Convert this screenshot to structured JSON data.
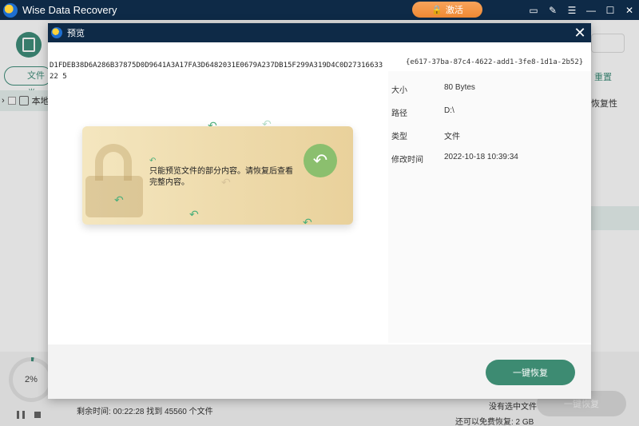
{
  "app": {
    "title": "Wise Data Recovery",
    "activate_label": "激活",
    "lock_glyph": "🔒"
  },
  "window_controls": {
    "feedback": "▭",
    "edit": "✎",
    "menu": "☰",
    "minimize": "—",
    "maximize": "☐",
    "close": "✕"
  },
  "background": {
    "file_tab_label": "文件类",
    "reset_label": "重置",
    "local_disk_label": "本地",
    "recoverable_label": "恢复性",
    "progress_percent": "2%",
    "progress_fraction": 0.02,
    "remaining_text": "剩余时间: 00:22:28 找到 45560 个文件",
    "no_selection_text": "没有选中文件",
    "free_left_text": "还可以免费恢复:  2 GB",
    "bg_recover_label": "一键恢复"
  },
  "dialog": {
    "title": "预览",
    "close_glyph": "✕",
    "hex_content": "D1FDEB38D6A286B37875D0D9641A3A17FA3D6482031E0679A237DB15F299A319D4C0D2731663322 5",
    "guid": "{e617-37ba-87c4-4622-add1-3fe8-1d1a-2b52}",
    "info": [
      {
        "key": "大小",
        "value": "80 Bytes"
      },
      {
        "key": "路径",
        "value": "D:\\"
      },
      {
        "key": "类型",
        "value": "文件"
      },
      {
        "key": "修改时间",
        "value": "2022-10-18 10:39:34"
      }
    ],
    "preview_message": "只能预览文件的部分内容。请恢复后查看完整内容。",
    "undo_glyph": "↶",
    "arrow_glyph": "↶",
    "recover_label": "一键恢复"
  }
}
